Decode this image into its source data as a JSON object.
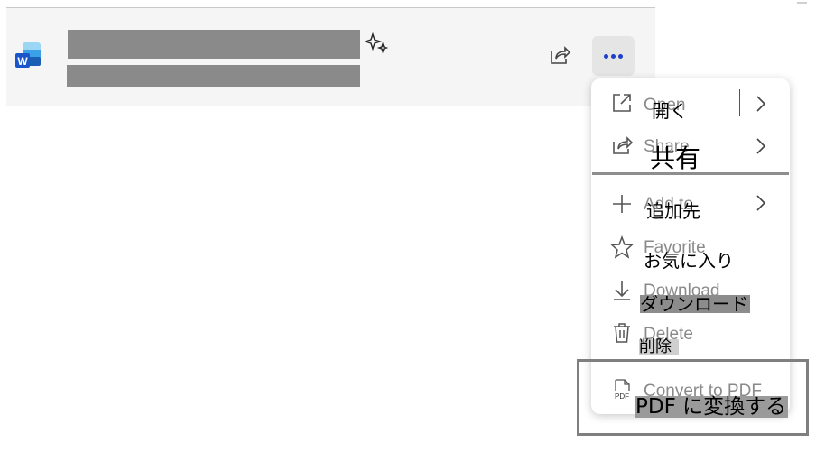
{
  "file_row": {
    "app_icon": "word-icon",
    "sparkle_icon": "sparkle-icon",
    "share_icon": "share-icon",
    "more_icon": "more-horizontal-icon"
  },
  "menu": {
    "items": [
      {
        "label_en": "Open",
        "label_ja": "開く",
        "icon": "open-external-icon",
        "has_submenu": true
      },
      {
        "label_en": "Share",
        "label_ja": "共有",
        "icon": "share-icon",
        "has_submenu": true
      },
      {
        "label_en": "Add to",
        "label_ja": "追加先",
        "icon": "plus-icon",
        "has_submenu": true
      },
      {
        "label_en": "Favorite",
        "label_ja": "お気に入り",
        "icon": "star-icon",
        "has_submenu": false
      },
      {
        "label_en": "Download",
        "label_ja": "ダウンロード",
        "icon": "download-icon",
        "has_submenu": false
      },
      {
        "label_en": "Delete",
        "label_ja": "削除",
        "icon": "trash-icon",
        "has_submenu": false
      },
      {
        "label_en": "Convert to PDF",
        "label_ja": "PDF に変換する",
        "icon": "pdf-file-icon",
        "has_submenu": false
      }
    ]
  },
  "colors": {
    "accent": "#1f3fc8",
    "menu_text": "#8a8a8a",
    "highlight": "#8c8c8c"
  }
}
